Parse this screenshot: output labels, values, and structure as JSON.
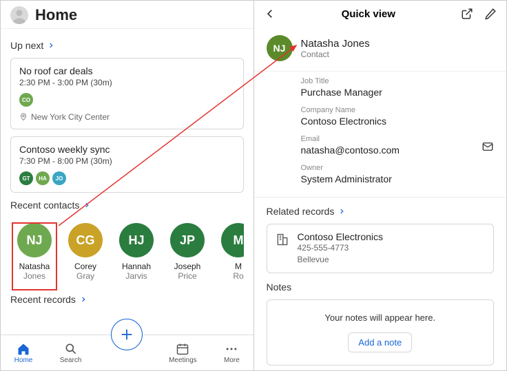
{
  "left": {
    "title": "Home",
    "upnext_label": "Up next",
    "events": [
      {
        "title": "No roof car deals",
        "time": "2:30 PM - 3:00 PM (30m)",
        "attendees": [
          {
            "initials": "CO",
            "color": "#6fa94f"
          }
        ],
        "location": "New York City Center"
      },
      {
        "title": "Contoso weekly sync",
        "time": "7:30 PM - 8:00 PM (30m)",
        "attendees": [
          {
            "initials": "GT",
            "color": "#2a7d3f"
          },
          {
            "initials": "HA",
            "color": "#6fa94f"
          },
          {
            "initials": "JO",
            "color": "#3aa6c4"
          }
        ]
      }
    ],
    "recent_contacts_label": "Recent contacts",
    "contacts": [
      {
        "initials": "NJ",
        "first": "Natasha",
        "last": "Jones",
        "color": "#6fa94f"
      },
      {
        "initials": "CG",
        "first": "Corey",
        "last": "Gray",
        "color": "#c9a227"
      },
      {
        "initials": "HJ",
        "first": "Hannah",
        "last": "Jarvis",
        "color": "#2a7d3f"
      },
      {
        "initials": "JP",
        "first": "Joseph",
        "last": "Price",
        "color": "#2a7d3f"
      },
      {
        "initials": "M",
        "first": "M",
        "last": "Ro",
        "color": "#2a7d3f"
      }
    ],
    "recent_records_label": "Recent records",
    "nav": {
      "home": "Home",
      "search": "Search",
      "meetings": "Meetings",
      "more": "More"
    }
  },
  "right": {
    "header": "Quick view",
    "contact": {
      "initials": "NJ",
      "avatar_color": "#5b8a2a",
      "name": "Natasha Jones",
      "type": "Contact"
    },
    "fields": {
      "job_title_label": "Job Title",
      "job_title_value": "Purchase Manager",
      "company_label": "Company Name",
      "company_value": "Contoso Electronics",
      "email_label": "Email",
      "email_value": "natasha@contoso.com",
      "owner_label": "Owner",
      "owner_value": "System Administrator"
    },
    "related_label": "Related records",
    "related": {
      "name": "Contoso Electronics",
      "phone": "425-555-4773",
      "city": "Bellevue"
    },
    "notes_label": "Notes",
    "notes_empty": "Your notes will appear here.",
    "add_note": "Add a note"
  }
}
